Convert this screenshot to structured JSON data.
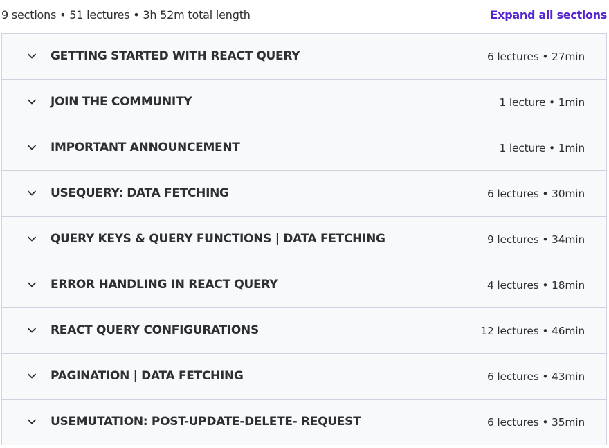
{
  "summary": {
    "text": "9 sections • 51 lectures • 3h 52m total length",
    "expand_label": "Expand all sections",
    "accent_color": "#5624d0"
  },
  "sections": [
    {
      "title": "GETTING STARTED WITH REACT QUERY",
      "meta": "6 lectures • 27min",
      "icon": "chevron-down-icon"
    },
    {
      "title": "JOIN THE COMMUNITY",
      "meta": "1 lecture • 1min",
      "icon": "chevron-down-icon"
    },
    {
      "title": "IMPORTANT ANNOUNCEMENT",
      "meta": "1 lecture • 1min",
      "icon": "chevron-down-icon"
    },
    {
      "title": "USEQUERY: DATA FETCHING",
      "meta": "6 lectures • 30min",
      "icon": "chevron-down-icon"
    },
    {
      "title": "QUERY KEYS & QUERY FUNCTIONS | DATA FETCHING",
      "meta": "9 lectures • 34min",
      "icon": "chevron-down-icon"
    },
    {
      "title": "ERROR HANDLING IN REACT QUERY",
      "meta": "4 lectures • 18min",
      "icon": "chevron-down-icon"
    },
    {
      "title": "REACT QUERY CONFIGURATIONS",
      "meta": "12 lectures • 46min",
      "icon": "chevron-down-icon"
    },
    {
      "title": "PAGINATION | DATA FETCHING",
      "meta": "6 lectures • 43min",
      "icon": "chevron-down-icon"
    },
    {
      "title": "USEMUTATION: POST-UPDATE-DELETE- REQUEST",
      "meta": "6 lectures • 35min",
      "icon": "chevron-down-icon"
    }
  ]
}
